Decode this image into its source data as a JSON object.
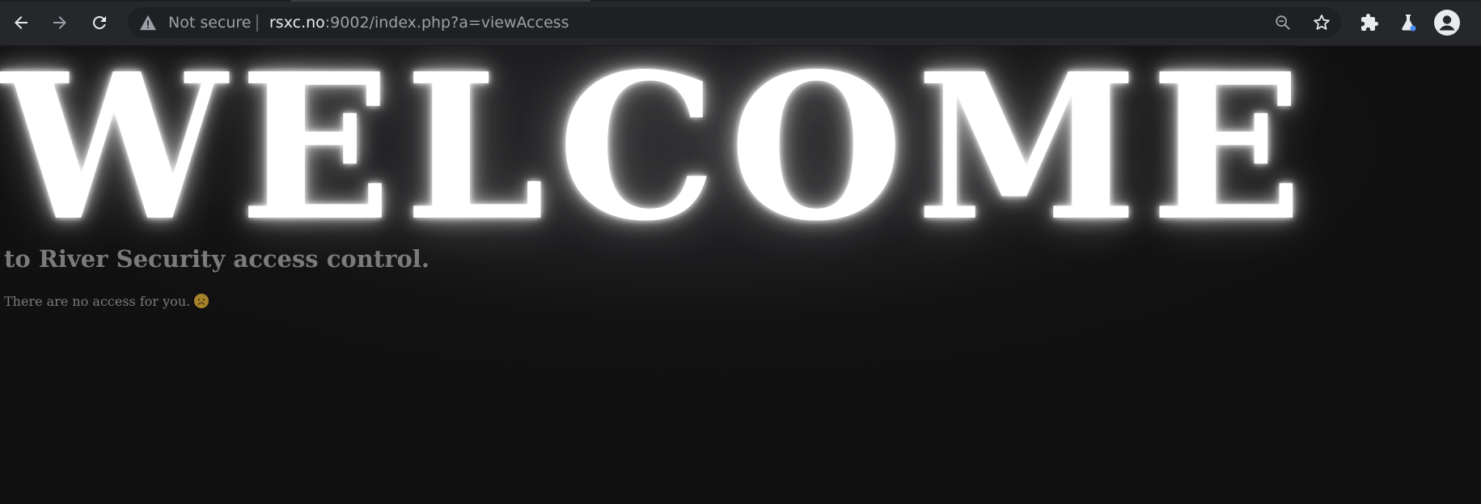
{
  "browser": {
    "nav": {
      "back": "back-arrow-icon",
      "forward": "forward-arrow-icon",
      "reload": "reload-icon"
    },
    "omnibox": {
      "security_label": "Not secure",
      "url_host": "rsxc.no",
      "url_rest": ":9002/index.php?a=viewAccess"
    },
    "actions": [
      "zoom-out-icon",
      "star-icon",
      "extensions-icon",
      "labs-flask-icon",
      "profile-avatar-icon"
    ]
  },
  "page": {
    "heading": "WELCOME",
    "subtitle": "to River Security access control.",
    "message": "There are no access for you.",
    "message_emoji": "worried-face-icon"
  },
  "colors": {
    "page_background": "#111112",
    "heading": "#ffffff",
    "body_text": "#7d7a7c",
    "toolbar": "#25272b",
    "omnibox": "#1f2023"
  }
}
